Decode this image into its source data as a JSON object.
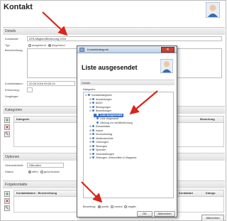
{
  "page": {
    "title": "Kontakt"
  },
  "details": {
    "section": "Details",
    "kontaktart_label": "Kontaktart:",
    "kontaktart_value": "ATB-Mitglied/Betreuung 2016",
    "typ_label": "Typ:",
    "typ_options": [
      "ausgehend",
      "eingehend"
    ],
    "beschreibung_label": "Beschreibung:",
    "kontaktdatum_label": "Kontaktdatum:",
    "kontaktdatum_value": "20.05.2016 09:03:10",
    "erinnerung_label": "Erinnerung:",
    "vorgaenger_label": "Vorgänger:"
  },
  "kategorien": {
    "section": "Kategorien",
    "col_kategorie": "Kategorie",
    "col_bewertung": "Bewertung"
  },
  "optionen": {
    "section": "Optionen",
    "vertraulichkeit_label": "Vertraulichkeit:",
    "vertraulichkeit_value": "Öffentlich",
    "status_label": "Status:",
    "status_options": [
      "offen",
      "geschlossen"
    ]
  },
  "folgekontakte": {
    "section": "Folgekontakte",
    "col_kontaktdatum": "Kontaktdatum",
    "col_beschreibung": "Beschreibung",
    "col_kontaktart": "Kontaktart",
    "col_kategorie": "Katego",
    "button_label": "Abbrechen"
  },
  "dialog": {
    "title": "Kontaktkategorie",
    "close_label": "✕",
    "heading": "Liste ausgesendet",
    "details_section": "Details",
    "kategorien_label": "Kategorien:",
    "tree": [
      {
        "label": "Kontaktkategorien",
        "depth": 0,
        "toggle": "⊟"
      },
      {
        "label": "Ausstellungen",
        "depth": 1,
        "toggle": "⊞"
      },
      {
        "label": "BASS",
        "depth": 1,
        "toggle": "⊞"
      },
      {
        "label": "Bewegungen",
        "depth": 1,
        "toggle": "⊞"
      },
      {
        "label": "Bewerbungen",
        "depth": 1,
        "toggle": "⊟"
      },
      {
        "label": "Liste ausgesendet",
        "depth": 2,
        "toggle": "",
        "selected": true
      },
      {
        "label": "Liste eingesandt",
        "depth": 2,
        "toggle": ""
      },
      {
        "label": "Zählung zur Veröffentlichung",
        "depth": 2,
        "toggle": ""
      },
      {
        "label": "Einkaufsliste",
        "depth": 1,
        "toggle": "⊞"
      },
      {
        "label": "Import",
        "depth": 1,
        "toggle": "⊞"
      },
      {
        "label": "Kirchenbeitrag",
        "depth": 1,
        "toggle": "⊞"
      },
      {
        "label": "Medienberichte",
        "depth": 1,
        "toggle": "⊞"
      },
      {
        "label": "Ordnungen",
        "depth": 1,
        "toggle": "⊞"
      },
      {
        "label": "Sitzungen",
        "depth": 1,
        "toggle": "⊞"
      },
      {
        "label": "Spenden",
        "depth": 1,
        "toggle": "⊞"
      },
      {
        "label": "Veranstaltungen",
        "depth": 1,
        "toggle": "⊞"
      },
      {
        "label": "Zeitungen, Zeitschriften & Magazine",
        "depth": 1,
        "toggle": "⊞"
      }
    ],
    "bewertung_label": "Bewertung:",
    "bewertung_options": [
      "positiv",
      "neutral",
      "negativ"
    ],
    "ok_label": "OK",
    "cancel_label": "Abbrechen"
  },
  "colors": {
    "arrow": "#d8261a",
    "selection": "#3870c8",
    "close": "#c94030"
  }
}
